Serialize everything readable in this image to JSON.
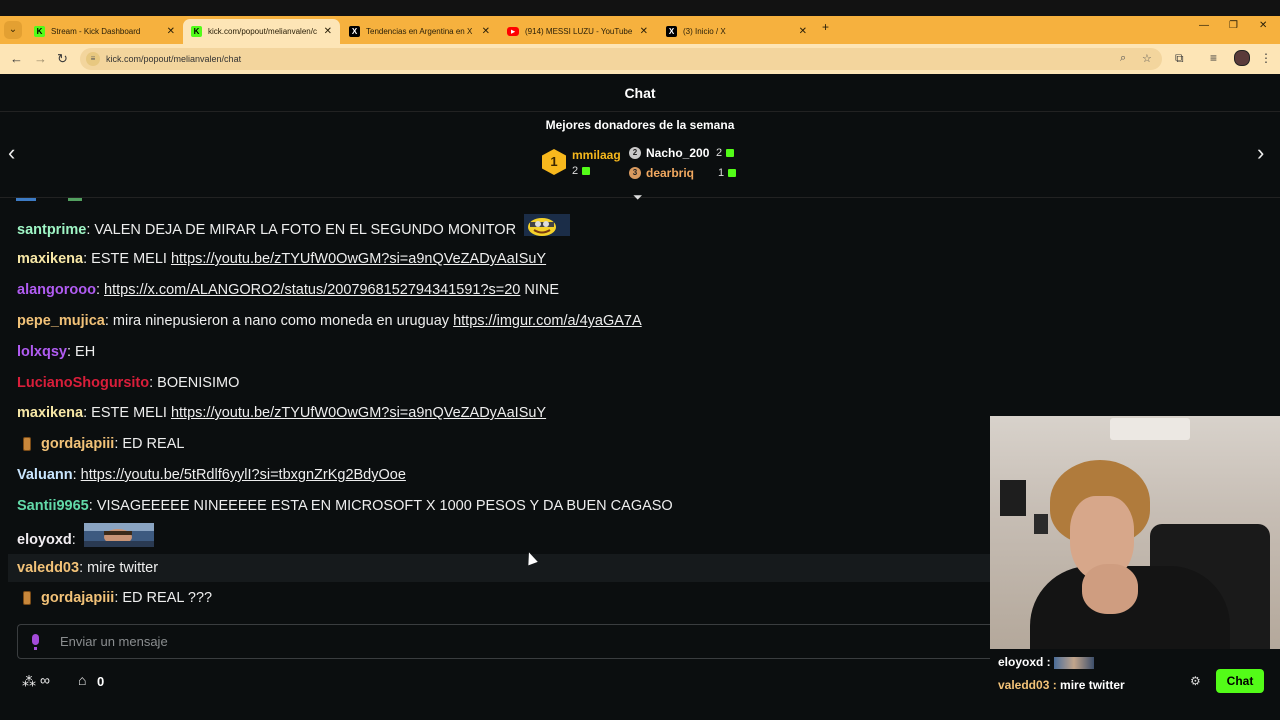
{
  "browser": {
    "tabs": [
      {
        "title": "Stream - Kick Dashboard",
        "icon": "kick-icon"
      },
      {
        "title": "kick.com/popout/melianvalen/c",
        "icon": "kick-icon"
      },
      {
        "title": "Tendencias en Argentina en X",
        "icon": "x-icon"
      },
      {
        "title": "(914) MESSI LUZU - YouTube",
        "icon": "youtube-icon"
      },
      {
        "title": "(3) Inicio / X",
        "icon": "x-icon"
      }
    ],
    "url": "kick.com/popout/melianvalen/chat"
  },
  "header": {
    "title": "Chat"
  },
  "donors": {
    "title": "Mejores donadores de la semana",
    "first": {
      "rank": "1",
      "name": "mmilaag",
      "count": "2"
    },
    "second": {
      "rank": "2",
      "name": "Nacho_200",
      "count": "2"
    },
    "third": {
      "rank": "3",
      "name": "dearbriq",
      "count": "1"
    }
  },
  "colors": {
    "accent": "#53fc18",
    "background": "#0b0e0f"
  },
  "messages": [
    {
      "user": "santprime",
      "color": "#9ff5c5",
      "text": "VALEN DEJA DE MIRAR LA FOTO EN EL SEGUNDO MONITOR",
      "emote": "minion-emote"
    },
    {
      "user": "maxikena",
      "color": "#f7e7a6",
      "text": "ESTE MELI",
      "link": "https://youtu.be/zTYUfW0OwGM?si=a9nQVeZADyAaISuY"
    },
    {
      "user": "alangorooo",
      "color": "#b15cf2",
      "link": "https://x.com/ALANGORO2/status/2007968152794341591?s=20",
      "text": "NINE"
    },
    {
      "user": "pepe_mujica",
      "color": "#f2c278",
      "text": "mira ninepusieron a nano como moneda en uruguay",
      "link": "https://imgur.com/a/4yaGA7A"
    },
    {
      "user": "lolxqsy",
      "color": "#b15cf2",
      "text": "EH"
    },
    {
      "user": "LucianoShogursito",
      "color": "#d91e3a",
      "text": "BOENISIMO"
    },
    {
      "user": "maxikena",
      "color": "#f7e7a6",
      "text": "ESTE MELI",
      "link": "https://youtu.be/zTYUfW0OwGM?si=a9nQVeZADyAaISuY"
    },
    {
      "user": "gordajapiii",
      "color": "#f2c278",
      "text": "ED REAL",
      "badge": true
    },
    {
      "user": "Valuann",
      "color": "#c9e6ff",
      "link": "https://youtu.be/5tRdlf6yylI?si=tbxgnZrKg2BdyOoe"
    },
    {
      "user": "Santii9965",
      "color": "#62d9a8",
      "text": "VISAGEEEEE NINEEEEE ESTA EN MICROSOFT X 1000 PESOS Y DA BUEN CAGASO"
    },
    {
      "user": "eloyoxd",
      "color": "#f2eef2",
      "emote": "photo-emote"
    },
    {
      "user": "valedd03",
      "color": "#f2c278",
      "text": "mire twitter",
      "highlight": true
    },
    {
      "user": "gordajapiii",
      "color": "#f2c278",
      "text": "ED REAL ???",
      "badge": true
    }
  ],
  "input": {
    "placeholder": "Enviar un mensaje"
  },
  "footer": {
    "points": "0"
  },
  "overlay": {
    "line1_user": "eloyoxd :",
    "line2_user": "valedd03 :",
    "line2_text": "mire twitter",
    "chat_button": "Chat"
  }
}
